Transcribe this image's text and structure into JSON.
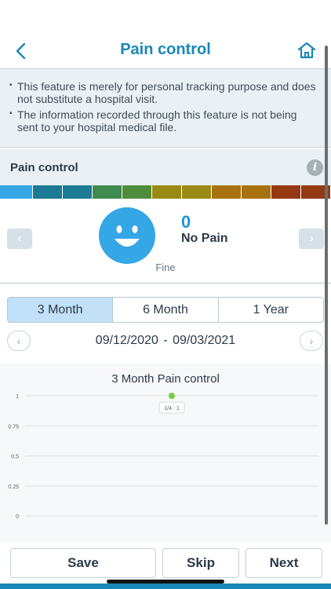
{
  "header": {
    "title": "Pain control",
    "back_icon": "chevron-left-icon",
    "home_icon": "home-icon"
  },
  "notice": {
    "items": [
      "This feature is merely for personal tracking purpose and does not substitute a hospital visit.",
      "The information recorded through this feature is not being sent to your hospital medical file."
    ]
  },
  "section": {
    "title": "Pain control",
    "info_icon": "info-icon",
    "info_glyph": "i"
  },
  "pain_scale": {
    "colors": [
      "#35a6e6",
      "#1b7a94",
      "#1b7a94",
      "#3f8a4e",
      "#4f8d3c",
      "#9a8a14",
      "#9a8a14",
      "#a8730f",
      "#a8730f",
      "#953913",
      "#953913"
    ],
    "selected_index": 0
  },
  "pain_current": {
    "value": "0",
    "label": "No Pain",
    "face_label": "Fine",
    "face_icon": "smiley-face-icon",
    "prev_glyph": "‹",
    "next_glyph": "›"
  },
  "range": {
    "tabs": [
      "3 Month",
      "6 Month",
      "1 Year"
    ],
    "active_tab": 0,
    "start_date": "09/12/2020",
    "separator": "-",
    "end_date": "09/03/2021",
    "prev_glyph": "‹",
    "next_glyph": "›"
  },
  "chart_data": {
    "type": "scatter",
    "title": "3 Month Pain control",
    "xlabel": "",
    "ylabel": "",
    "ylim": [
      0,
      1
    ],
    "yticks": [
      "1",
      "0.75",
      "0.5",
      "0.25",
      "0"
    ],
    "points": [
      {
        "x": 0.5,
        "y": 1,
        "label": "1/4 : 1"
      }
    ],
    "point_color": "#7ac943",
    "grid": true
  },
  "actions": {
    "save": "Save",
    "skip": "Skip",
    "next": "Next"
  },
  "colors": {
    "accent": "#1a87b8",
    "face": "#35a6e6",
    "panel": "#eaf1f6",
    "active_tab": "#c2e0f7"
  }
}
